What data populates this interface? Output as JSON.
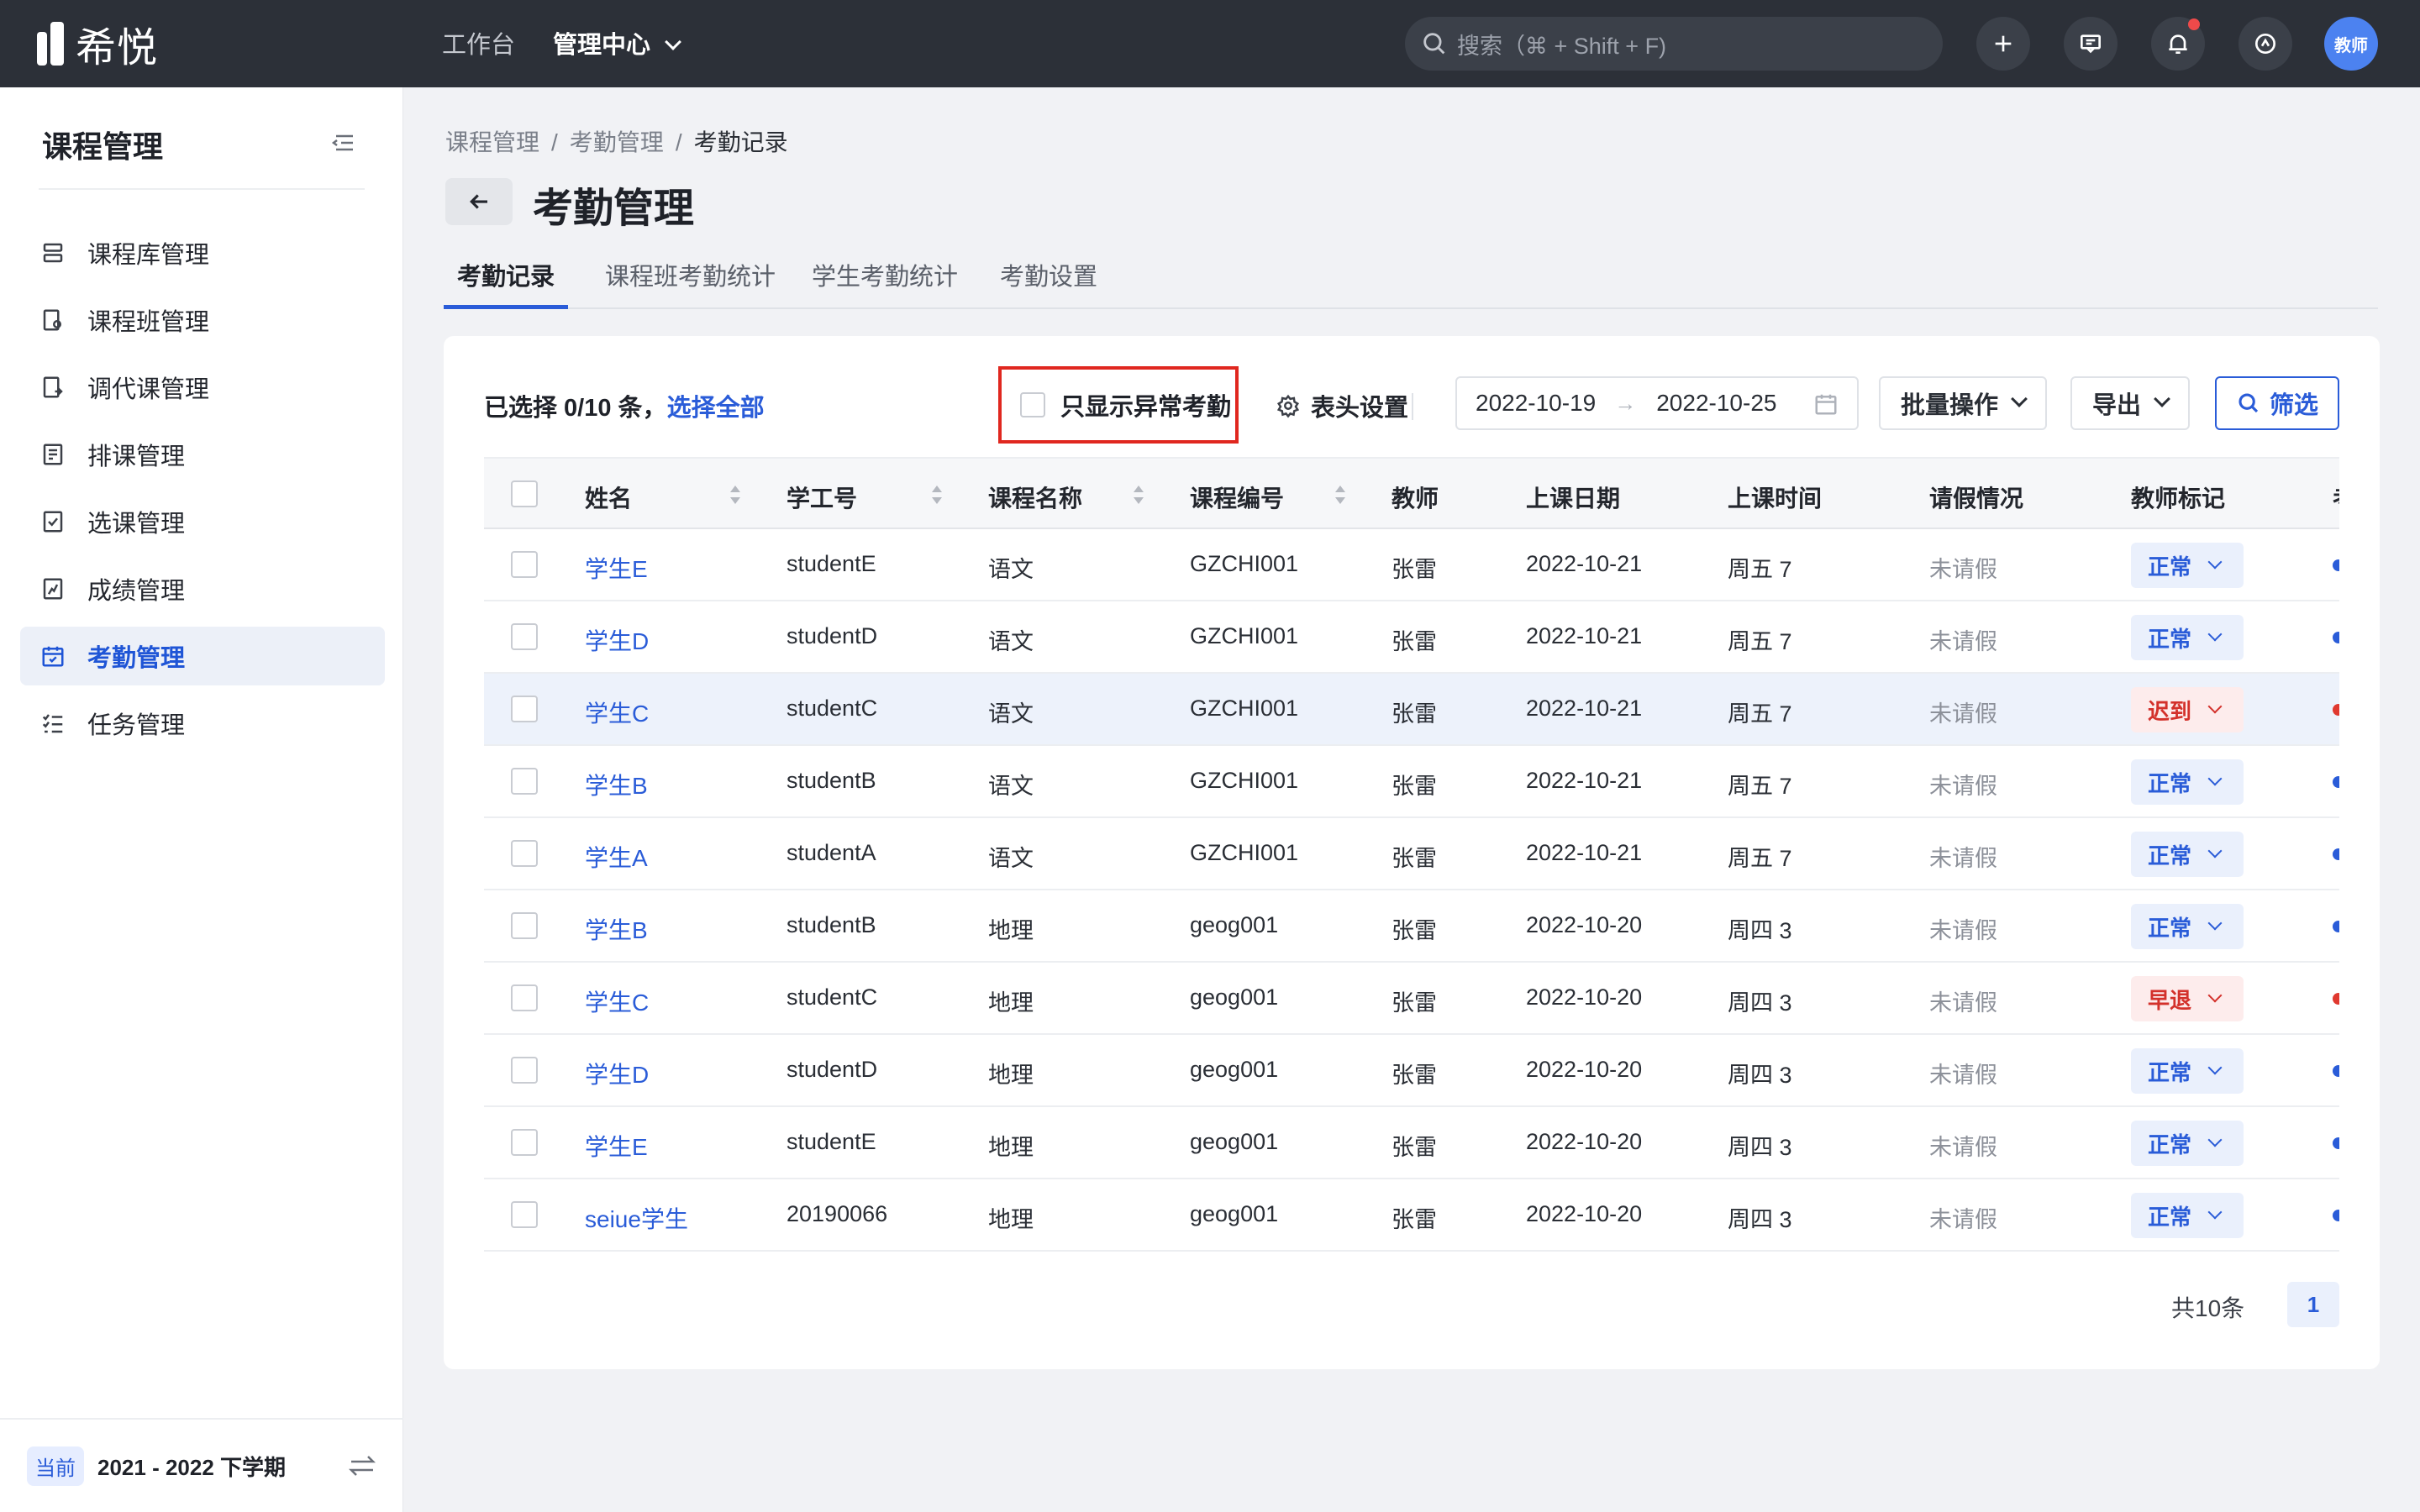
{
  "topbar": {
    "logo_text": "希悦",
    "nav": [
      {
        "label": "工作台",
        "active": false
      },
      {
        "label": "管理中心",
        "active": true
      }
    ],
    "search_placeholder": "搜索（⌘ + Shift + F)",
    "avatar_text": "教师",
    "icons": [
      "plus-icon",
      "message-icon",
      "bell-icon",
      "help-icon"
    ]
  },
  "sidebar": {
    "title": "课程管理",
    "items": [
      {
        "label": "课程库管理",
        "icon": "library-icon"
      },
      {
        "label": "课程班管理",
        "icon": "class-icon"
      },
      {
        "label": "调代课管理",
        "icon": "substitute-icon"
      },
      {
        "label": "排课管理",
        "icon": "schedule-icon"
      },
      {
        "label": "选课管理",
        "icon": "select-course-icon"
      },
      {
        "label": "成绩管理",
        "icon": "grade-icon"
      },
      {
        "label": "考勤管理",
        "icon": "calendar-check-icon",
        "active": true
      },
      {
        "label": "任务管理",
        "icon": "task-list-icon"
      }
    ],
    "term_badge": "当前",
    "term_text": "2021 - 2022 下学期"
  },
  "breadcrumb": [
    "课程管理",
    "考勤管理",
    "考勤记录"
  ],
  "page_title": "考勤管理",
  "tabs": [
    {
      "label": "考勤记录",
      "active": true
    },
    {
      "label": "课程班考勤统计"
    },
    {
      "label": "学生考勤统计"
    },
    {
      "label": "考勤设置"
    }
  ],
  "toolbar": {
    "selection_prefix": "已选择 0/10 条，",
    "select_all": "选择全部",
    "abnormal_only": "只显示异常考勤",
    "column_settings": "表头设置",
    "date_start": "2022-10-19",
    "date_arrow": "→",
    "date_end": "2022-10-25",
    "batch": "批量操作",
    "export": "导出",
    "filter": "筛选"
  },
  "table": {
    "columns": [
      "姓名",
      "学工号",
      "课程名称",
      "课程编号",
      "教师",
      "上课日期",
      "上课时间",
      "请假情况",
      "教师标记",
      "考"
    ],
    "rows": [
      {
        "name": "学生E",
        "id": "studentE",
        "course": "语文",
        "code": "GZCHI001",
        "teacher": "张雷",
        "date": "2022-10-21",
        "time": "周五 7",
        "leave": "未请假",
        "mark": "正常",
        "status": "normal"
      },
      {
        "name": "学生D",
        "id": "studentD",
        "course": "语文",
        "code": "GZCHI001",
        "teacher": "张雷",
        "date": "2022-10-21",
        "time": "周五 7",
        "leave": "未请假",
        "mark": "正常",
        "status": "normal"
      },
      {
        "name": "学生C",
        "id": "studentC",
        "course": "语文",
        "code": "GZCHI001",
        "teacher": "张雷",
        "date": "2022-10-21",
        "time": "周五 7",
        "leave": "未请假",
        "mark": "迟到",
        "status": "bad",
        "highlight": true
      },
      {
        "name": "学生B",
        "id": "studentB",
        "course": "语文",
        "code": "GZCHI001",
        "teacher": "张雷",
        "date": "2022-10-21",
        "time": "周五 7",
        "leave": "未请假",
        "mark": "正常",
        "status": "normal"
      },
      {
        "name": "学生A",
        "id": "studentA",
        "course": "语文",
        "code": "GZCHI001",
        "teacher": "张雷",
        "date": "2022-10-21",
        "time": "周五 7",
        "leave": "未请假",
        "mark": "正常",
        "status": "normal"
      },
      {
        "name": "学生B",
        "id": "studentB",
        "course": "地理",
        "code": "geog001",
        "teacher": "张雷",
        "date": "2022-10-20",
        "time": "周四 3",
        "leave": "未请假",
        "mark": "正常",
        "status": "normal"
      },
      {
        "name": "学生C",
        "id": "studentC",
        "course": "地理",
        "code": "geog001",
        "teacher": "张雷",
        "date": "2022-10-20",
        "time": "周四 3",
        "leave": "未请假",
        "mark": "早退",
        "status": "bad"
      },
      {
        "name": "学生D",
        "id": "studentD",
        "course": "地理",
        "code": "geog001",
        "teacher": "张雷",
        "date": "2022-10-20",
        "time": "周四 3",
        "leave": "未请假",
        "mark": "正常",
        "status": "normal"
      },
      {
        "name": "学生E",
        "id": "studentE",
        "course": "地理",
        "code": "geog001",
        "teacher": "张雷",
        "date": "2022-10-20",
        "time": "周四 3",
        "leave": "未请假",
        "mark": "正常",
        "status": "normal"
      },
      {
        "name": "seiue学生",
        "id": "20190066",
        "course": "地理",
        "code": "geog001",
        "teacher": "张雷",
        "date": "2022-10-20",
        "time": "周四 3",
        "leave": "未请假",
        "mark": "正常",
        "status": "normal"
      }
    ]
  },
  "pagination": {
    "total": "共10条",
    "current": "1"
  },
  "colors": {
    "accent": "#2a5cd8",
    "topbar": "#2c3038",
    "normal_dot": "#2a5cd8",
    "bad_dot": "#e0392f",
    "highlight_border": "#e0271f"
  }
}
